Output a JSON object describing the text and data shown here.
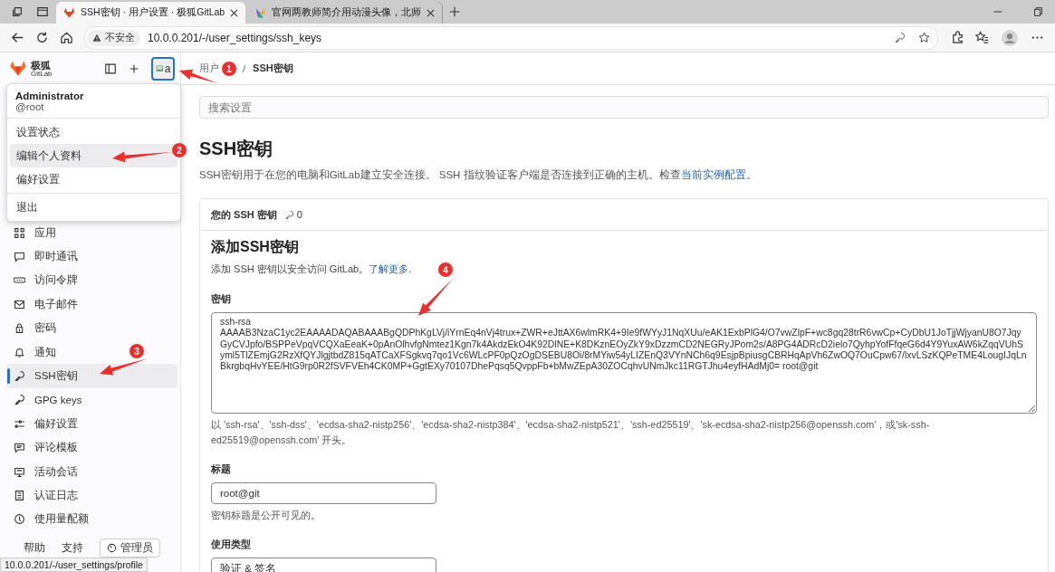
{
  "browser": {
    "tabs": [
      {
        "title": "SSH密钥 · 用户设置 · 极狐GitLab",
        "selected": true
      },
      {
        "title": "官网两教师简介用动漫头像，北师",
        "selected": false
      }
    ],
    "security": "不安全",
    "url": "10.0.0.201/-/user_settings/ssh_keys"
  },
  "sidebar": {
    "brand": "极狐",
    "brand_sub": "GitLab",
    "avatar_text": "a",
    "user_menu": {
      "name": "Administrator",
      "username": "@root",
      "items": [
        {
          "label": "设置状态",
          "selected": false
        },
        {
          "label": "编辑个人资料",
          "selected": true
        },
        {
          "label": "偏好设置",
          "selected": false
        }
      ],
      "signout": "退出"
    },
    "items": [
      {
        "label": "应用",
        "selected": false
      },
      {
        "label": "即时通讯",
        "selected": false
      },
      {
        "label": "访问令牌",
        "selected": false
      },
      {
        "label": "电子邮件",
        "selected": false
      },
      {
        "label": "密码",
        "selected": false
      },
      {
        "label": "通知",
        "selected": false
      },
      {
        "label": "SSH密钥",
        "selected": true
      },
      {
        "label": "GPG keys",
        "selected": false
      },
      {
        "label": "偏好设置",
        "selected": false
      },
      {
        "label": "评论模板",
        "selected": false
      },
      {
        "label": "活动会话",
        "selected": false
      },
      {
        "label": "认证日志",
        "selected": false
      },
      {
        "label": "使用量配额",
        "selected": false
      }
    ],
    "footer": {
      "help": "帮助",
      "support": "支持",
      "admin": "管理员"
    }
  },
  "breadcrumb": [
    "用户",
    "SSH密钥"
  ],
  "breadcrumb_separator": "/",
  "search": {
    "placeholder": "搜索设置"
  },
  "page": {
    "title": "SSH密钥",
    "description": "SSH密钥用于在您的电脑和GitLab建立安全连接。 SSH 指纹验证客户端是否连接到正确的主机。检查",
    "description_link": "当前实例配置",
    "description_end": "。"
  },
  "card": {
    "title": "您的 SSH 密钥",
    "count": "0",
    "form": {
      "title": "添加SSH密钥",
      "subtitle": "添加 SSH 密钥以安全访问 GitLab。",
      "subtitle_link": "了解更多.",
      "key_label": "密钥",
      "key_value": "ssh-rsa\nAAAAB3NzaC1yc2EAAAADAQABAAABgQDPhKgLVj/iYrnEq4nVj4trux+ZWR+eJttAX6wlmRK4+9Ie9fWYyJ1NqXUu/eAK1ExbPlG4/O7vwZlpF+wc8gq28trR6vwCp+CyDbU1JoTjjWjyanU8O7JqyGyCVJpfo/BSPPeVpqVCQXaEeaK+0pAnOlhvfgNmtez1Kgn7k4AkdzEkO4K92DlNE+K8DKznEOyZkY9xDzzmCD2NEGRyJPom2s/A8PG4ADRcD2ielo7QyhpYofFfqeG6d4Y9YuxAW6kZqqVUhSyml5TlZEmjG2RzXfQYJlgjtbdZ815qATCaXFSgkvq7qo1Vc6WLcPF0pQzOgDSEBU8Oi/8rMYiw54yLIZEnQ3VYnNCh6q9EsjpBpiusgCBRHqApVh6ZwOQ7OuCpw67/lxvLSzKQPeTME4LougIJqLnBkrgbqHvYEE/HtG9rp0R2fSVFVEh4CK0MP+GgtEXy70107DhePqsq5QvppFb+bMwZEpA30ZOCqhvUNmJkc11RGTJhu4eyfHAdMj0= root@git",
      "key_help": "以 'ssh-rsa'、'ssh-dss'、'ecdsa-sha2-nistp256'、'ecdsa-sha2-nistp384'、'ecdsa-sha2-nistp521'、'ssh-ed25519'、'sk-ecdsa-sha2-nistp256@openssh.com'，或'sk-ssh-ed25519@openssh.com' 开头。",
      "title_label": "标题",
      "title_value": "root@git",
      "title_help": "密钥标题是公开可见的。",
      "usage_label": "使用类型",
      "usage_value": "验证 & 签名"
    }
  },
  "status_bar": "10.0.0.201/-/user_settings/profile",
  "annotations": [
    {
      "number": "1"
    },
    {
      "number": "2"
    },
    {
      "number": "3"
    },
    {
      "number": "4"
    }
  ]
}
